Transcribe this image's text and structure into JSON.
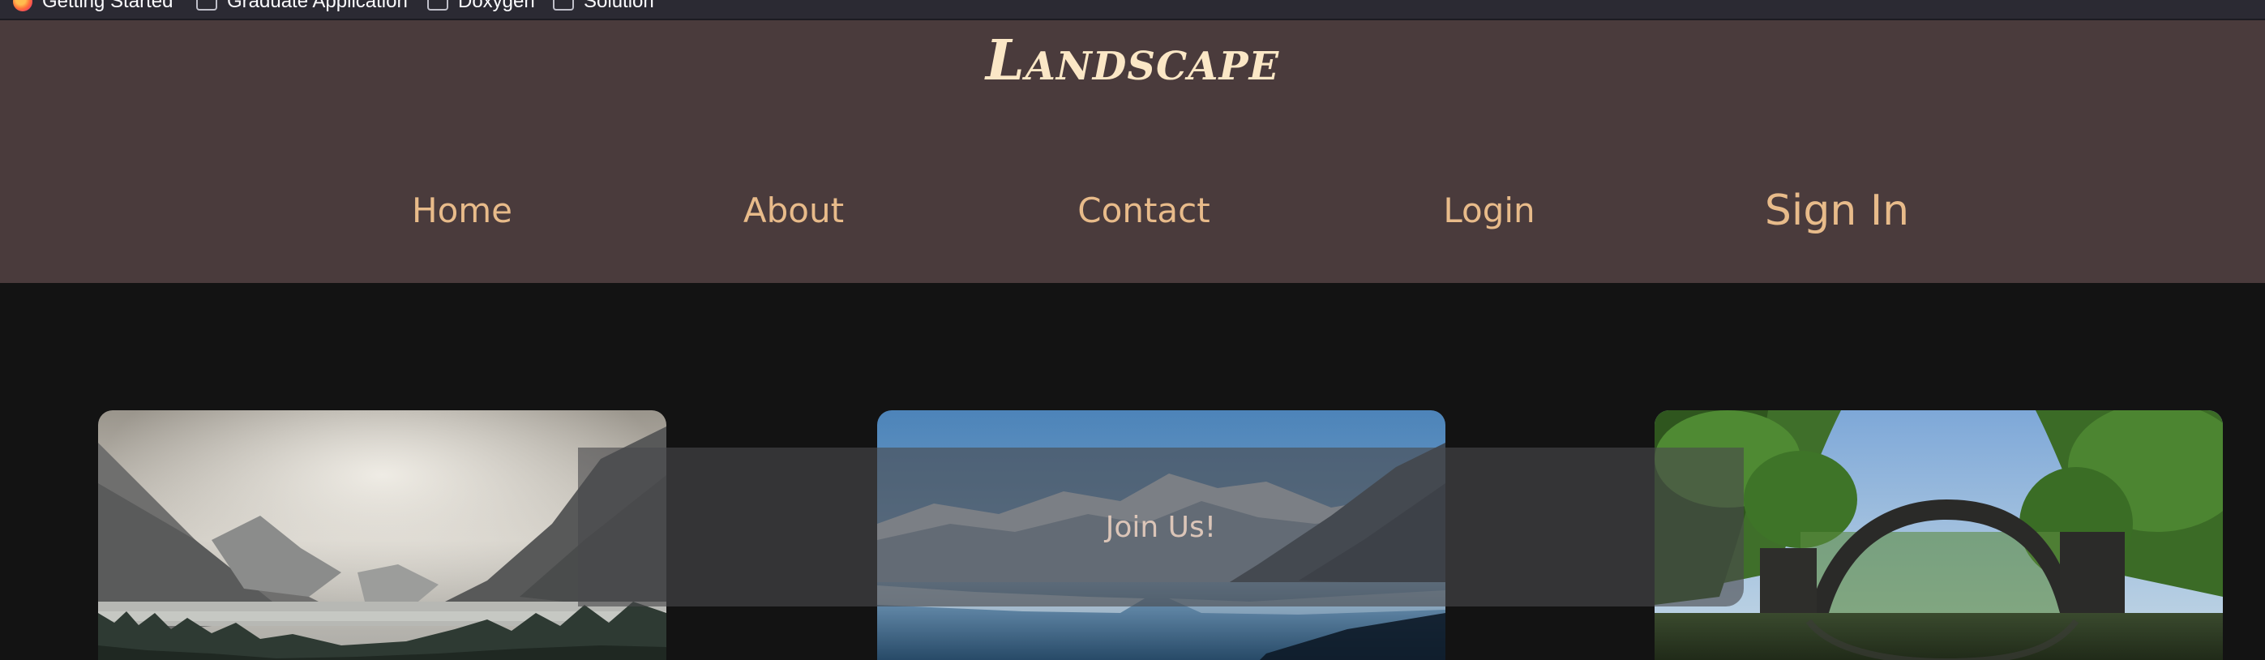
{
  "bookmarks": [
    {
      "label": "Getting Started",
      "icon": "firefox-icon"
    },
    {
      "label": "Graduate Application",
      "icon": "folder-icon"
    },
    {
      "label": "Doxygen",
      "icon": "folder-icon"
    },
    {
      "label": "Solution",
      "icon": "folder-icon"
    }
  ],
  "header": {
    "logo": "Landscape",
    "nav": {
      "home": "Home",
      "about": "About",
      "contact": "Contact",
      "login": "Login",
      "sign_in": "Sign In"
    }
  },
  "join": {
    "label": "Join Us!"
  },
  "colors": {
    "header_bg": "#4a3b3c",
    "logo": "#fbe7c6",
    "nav_text": "#e8bb8a",
    "page_bg": "#131313"
  }
}
